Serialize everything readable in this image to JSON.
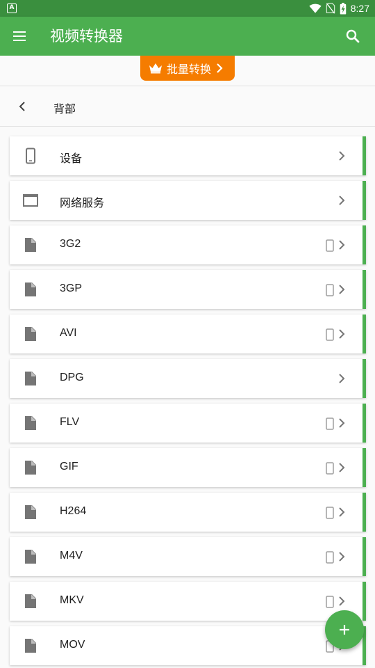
{
  "status_bar": {
    "time": "8:27",
    "left_icon_letter": "A",
    "icons": [
      "wifi-icon",
      "no-sim-icon",
      "battery-charging-icon"
    ]
  },
  "app_bar": {
    "title": "视频转换器",
    "menu_icon": "menu-icon",
    "search_icon": "search-icon"
  },
  "promo": {
    "label": "批量转换",
    "icon": "crown-icon"
  },
  "nav": {
    "title": "背部",
    "back_icon": "chevron-left-icon"
  },
  "items": [
    {
      "label": "设备",
      "icon": "phone-icon",
      "device": false
    },
    {
      "label": "网络服务",
      "icon": "window-icon",
      "device": false
    },
    {
      "label": "3G2",
      "icon": "file-icon",
      "device": true
    },
    {
      "label": "3GP",
      "icon": "file-icon",
      "device": true
    },
    {
      "label": "AVI",
      "icon": "file-icon",
      "device": true
    },
    {
      "label": "DPG",
      "icon": "file-icon",
      "device": false
    },
    {
      "label": "FLV",
      "icon": "file-icon",
      "device": true
    },
    {
      "label": "GIF",
      "icon": "file-icon",
      "device": true
    },
    {
      "label": "H264",
      "icon": "file-icon",
      "device": true
    },
    {
      "label": "M4V",
      "icon": "file-icon",
      "device": true
    },
    {
      "label": "MKV",
      "icon": "file-icon",
      "device": true
    },
    {
      "label": "MOV",
      "icon": "file-icon",
      "device": true
    }
  ],
  "fab": {
    "icon": "plus-icon"
  },
  "colors": {
    "primary": "#4caf50",
    "primary_dark": "#3a8f3e",
    "accent": "#f57c00",
    "icon_gray": "#757575"
  }
}
